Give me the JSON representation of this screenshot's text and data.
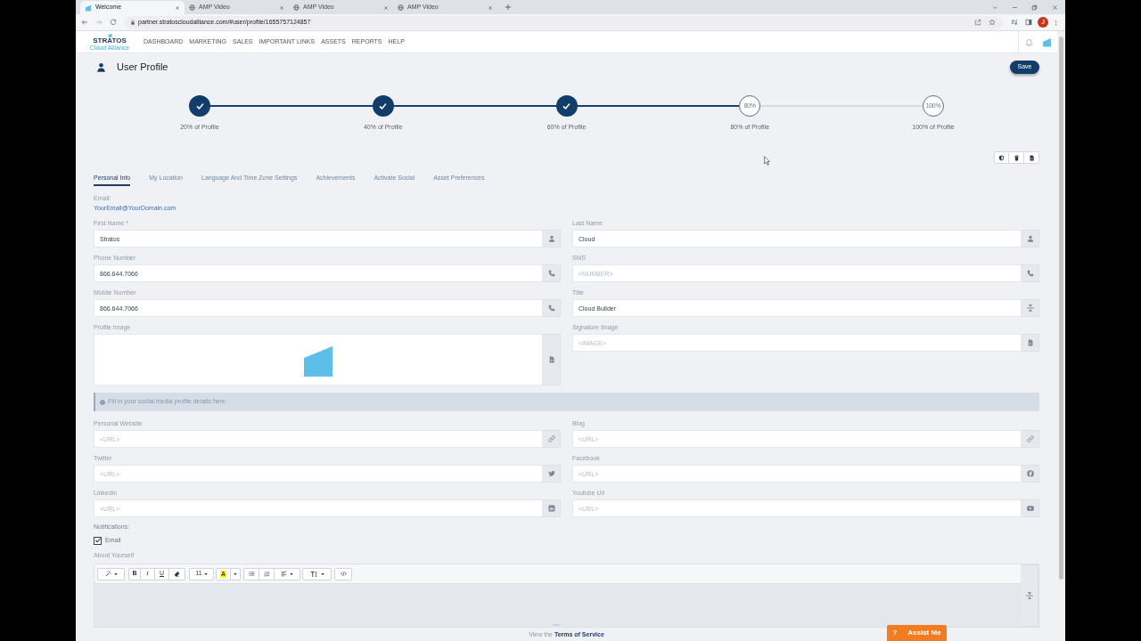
{
  "browser": {
    "tabs": [
      {
        "title": "Welcome",
        "selected": true
      },
      {
        "title": "AMP Video",
        "selected": false
      },
      {
        "title": "AMP Video",
        "selected": false
      },
      {
        "title": "AMP Video",
        "selected": false
      }
    ],
    "url": "partner.stratoscloudalliance.com/#user/profile/1655757124857",
    "profile_initial": "J"
  },
  "nav": {
    "logo_name": "STRATOS",
    "logo_tagline": "Cloud Alliance",
    "items": [
      "DASHBOARD",
      "MARKETING",
      "SALES",
      "IMPORTANT LINKS",
      "ASSETS",
      "REPORTS",
      "HELP"
    ]
  },
  "header": {
    "title": "User Profile",
    "save_button": "Save"
  },
  "steps": [
    {
      "label": "20% of Profile",
      "completed": true
    },
    {
      "label": "40% of Profile",
      "completed": true
    },
    {
      "label": "60% of Profile",
      "completed": true
    },
    {
      "label": "80% of Profile",
      "completed": false,
      "marker": "80%"
    },
    {
      "label": "100% of Profile",
      "completed": false,
      "marker": "100%"
    }
  ],
  "tabs": [
    {
      "label": "Personal Info",
      "selected": true
    },
    {
      "label": "My Location",
      "selected": false
    },
    {
      "label": "Language And Time Zone Settings",
      "selected": false
    },
    {
      "label": "Achievements",
      "selected": false
    },
    {
      "label": "Activate Social",
      "selected": false
    },
    {
      "label": "Asset Preferences",
      "selected": false
    }
  ],
  "email": {
    "label": "Email:",
    "value": "YourEmail@YourDomain.com"
  },
  "fields": [
    {
      "label": "First Name *",
      "value": "Stratos",
      "kind": "input"
    },
    {
      "label": "Last Name",
      "value": "Cloud",
      "kind": "input"
    },
    {
      "label": "Phone Number",
      "value": "866.644.7066",
      "kind": "input"
    },
    {
      "label": "SMS",
      "placeholder": "<NUMBER>",
      "kind": "input"
    },
    {
      "label": "Mobile Number",
      "value": "866.644.7066",
      "kind": "input"
    },
    {
      "label": "Title",
      "value": "Cloud Builder",
      "kind": "input"
    },
    {
      "label": "Profile Image",
      "kind": "image"
    },
    {
      "label": "Signature Image",
      "placeholder": "<IMAGE>",
      "kind": "input"
    }
  ],
  "social": {
    "notice": "Fill in your social media profile details here.",
    "fields": [
      {
        "label": "Personal Website",
        "placeholder": "<URL>"
      },
      {
        "label": "Blog",
        "placeholder": "<URL>"
      },
      {
        "label": "Twitter",
        "placeholder": "<URL>"
      },
      {
        "label": "Facebook",
        "placeholder": "<URL>"
      },
      {
        "label": "Linkedin",
        "placeholder": "<URL>"
      },
      {
        "label": "Youtube Url",
        "placeholder": "<URL>"
      }
    ]
  },
  "notifications": {
    "label": "Notifications:",
    "options": [
      {
        "label": "Email",
        "checked": true
      }
    ]
  },
  "about": {
    "label": "About Yourself",
    "toolbar": {
      "bold": "B",
      "italic": "I",
      "underline": "U",
      "font_size": "11",
      "highlight": "A"
    }
  },
  "footer": {
    "text": "View the",
    "link": "Terms of Service"
  },
  "assist": {
    "mark": "?",
    "label": "Assist Me"
  }
}
